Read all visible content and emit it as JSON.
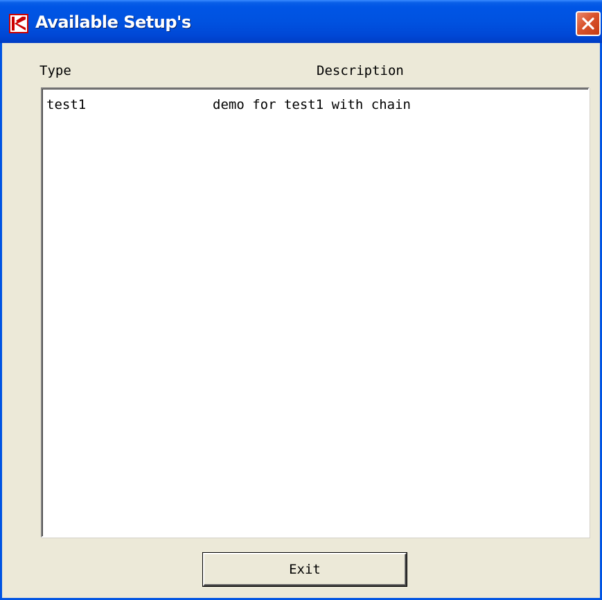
{
  "window": {
    "title": "Available Setup's",
    "app_icon": "k-logo-icon",
    "close_icon": "close-icon"
  },
  "columns": {
    "type_header": "Type",
    "description_header": "Description"
  },
  "setups": [
    {
      "type": "test1",
      "description": "demo for test1 with chain"
    }
  ],
  "buttons": {
    "exit_label": "Exit"
  },
  "colors": {
    "titlebar_blue": "#0055e5",
    "dialog_background": "#ece9d8",
    "close_red": "#d9532d",
    "logo_red": "#cc0000"
  }
}
